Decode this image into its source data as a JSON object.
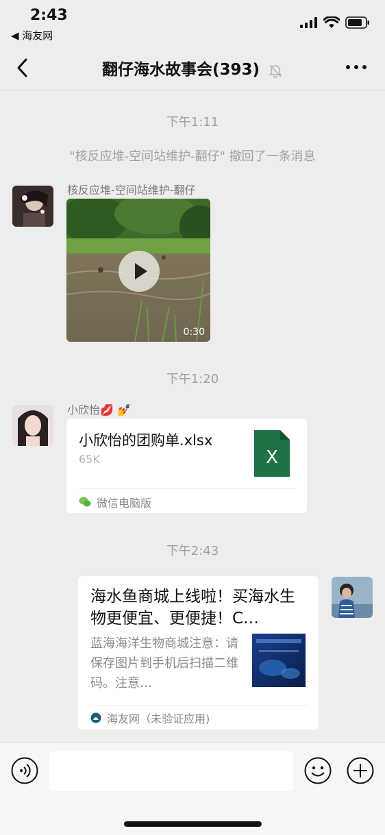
{
  "status_bar": {
    "time": "2:43",
    "back_app": "◀ 海友网"
  },
  "nav": {
    "title": "翻仔海水故事会(393)"
  },
  "messages": {
    "ts1": "下午1:11",
    "recall": "\"核反应堆-空间站维护-翻仔\" 撤回了一条消息",
    "video_sender": "核反应堆-空间站维护-翻仔",
    "video_duration": "0:30",
    "ts2": "下午1:20",
    "file_sender": "小欣怡💋 💅",
    "file_name": "小欣怡的团购单.xlsx",
    "file_size": "65K",
    "file_icon_letter": "X",
    "file_source": "微信电脑版",
    "ts3": "下午2:43",
    "link_title": "海水鱼商城上线啦！买海水生物更便宜、更便捷！C…",
    "link_desc": "蓝海海洋生物商城注意：请保存图片到手机后扫描二维码。注意…",
    "link_source": "海友网（未验证应用)"
  },
  "colors": {
    "bg": "#ededed",
    "excel_green": "#1f7244",
    "gray_text": "#a0a0a0"
  }
}
